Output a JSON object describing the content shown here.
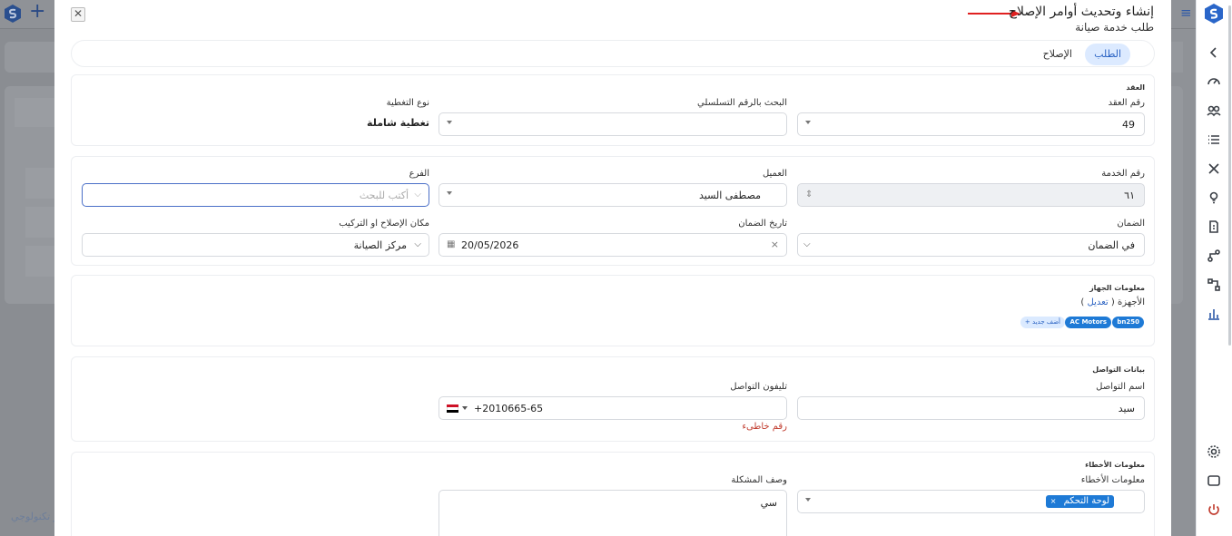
{
  "modal": {
    "title": "إنشاء وتحديث أوامر الإصلاح",
    "subtitle": "طلب خدمة صيانة"
  },
  "tabs": [
    {
      "label": "الطلب",
      "active": true
    },
    {
      "label": "الإصلاح",
      "active": false
    }
  ],
  "contract": {
    "section_title": "العقد",
    "contract_no_label": "رقم العقد",
    "contract_no_value": "49",
    "serial_search_label": "البحث بالرقم التسلسلي",
    "serial_search_value": "",
    "coverage_label": "نوع التغطية",
    "coverage_value": "تغطية شاملة"
  },
  "service": {
    "service_no_label": "رقم الخدمة",
    "service_no_value": "٦١",
    "customer_label": "العميل",
    "customer_value": "مصطفى السيد",
    "branch_label": "الفرع",
    "branch_placeholder": "أكتب للبحث",
    "warranty_label": "الضمان",
    "warranty_value": "في الضمان",
    "warranty_date_label": "تاريخ الضمان",
    "warranty_date_value": "20/05/2026",
    "repair_place_label": "مكان الإصلاح او التركيب",
    "repair_place_value": "مركز الصيانة"
  },
  "device": {
    "section_title": "معلومات الجهاز",
    "devices_label": "الأجهزة (",
    "edit_link": "تعديل",
    "devices_label_end": ")",
    "tags": [
      "bn250",
      "AC Motors"
    ],
    "add_new": "+ أضف جديد"
  },
  "contact": {
    "section_title": "بيانات التواصل",
    "name_label": "اسم التواصل",
    "name_value": "سيد",
    "phone_label": "تليفون التواصل",
    "phone_value": "+2010665-65",
    "phone_error": "رقم خاطىء"
  },
  "faults": {
    "section_title": "معلومات الأخطاء",
    "faults_label": "معلومات الأخطاء",
    "fault_tag": "لوحة التحكم",
    "desc_label": "وصف المشكلة",
    "desc_value": "سي"
  },
  "background": {
    "footer_text": "ر تكنولوجي"
  },
  "colors": {
    "accent": "#1e7ad6",
    "tab_active_bg": "#dceaff",
    "error": "#c0392b",
    "arrow": "#e02020"
  }
}
